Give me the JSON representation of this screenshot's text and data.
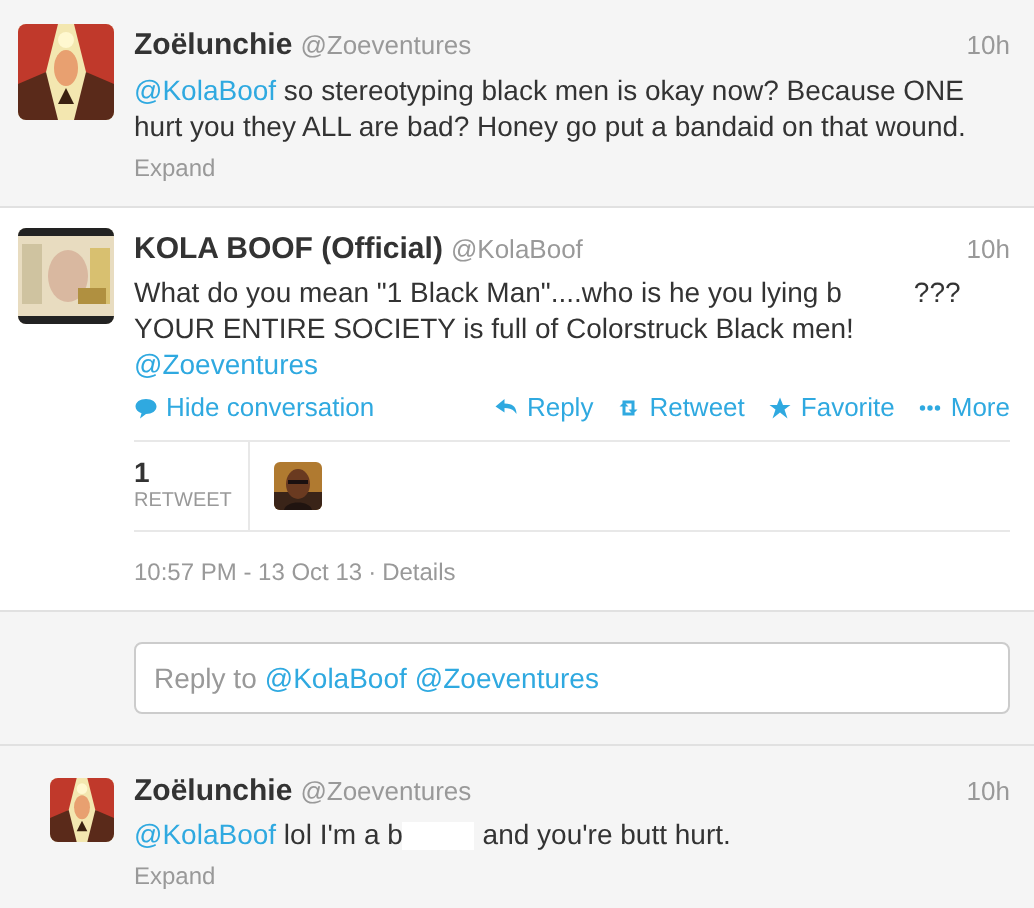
{
  "tweets": [
    {
      "kind": "collapsed",
      "name": "Zoëlunchie",
      "handle": "@Zoeventures",
      "time": "10h",
      "body": [
        {
          "kind": "mention",
          "text": "@KolaBoof"
        },
        {
          "kind": "text",
          "text": " so stereotyping black men is okay now? Because ONE hurt you they ALL are bad? Honey go put a bandaid on that wound."
        }
      ],
      "expand": "Expand"
    },
    {
      "kind": "open",
      "name": "KOLA BOOF (Official)",
      "handle": "@KolaBoof",
      "time": "10h",
      "body": [
        {
          "kind": "text",
          "text": "What do you mean \"1 Black Man\"....who is he you lying b"
        },
        {
          "kind": "redaction"
        },
        {
          "kind": "text",
          "text": "???"
        },
        {
          "kind": "break"
        },
        {
          "kind": "text",
          "text": "YOUR ENTIRE SOCIETY is full of Colorstruck Black men!"
        },
        {
          "kind": "break"
        },
        {
          "kind": "mention",
          "text": "@Zoeventures"
        }
      ],
      "hide_conversation": "Hide conversation",
      "actions": [
        {
          "kind": "reply",
          "label": "Reply"
        },
        {
          "kind": "retweet",
          "label": "Retweet"
        },
        {
          "kind": "favorite",
          "label": "Favorite"
        },
        {
          "kind": "more",
          "label": "More"
        }
      ],
      "stats": {
        "count": "1",
        "label": "RETWEET"
      },
      "timestamp": "10:57 PM - 13 Oct 13",
      "separator": "·",
      "details": "Details"
    },
    {
      "kind": "reply_box",
      "prefix": "Reply to",
      "mentions": [
        "@KolaBoof",
        "@Zoeventures"
      ]
    },
    {
      "kind": "collapsed",
      "name": "Zoëlunchie",
      "handle": "@Zoeventures",
      "time": "10h",
      "body": [
        {
          "kind": "mention",
          "text": "@KolaBoof"
        },
        {
          "kind": "text",
          "text": " lol I'm a b"
        },
        {
          "kind": "redaction"
        },
        {
          "kind": "text",
          "text": " and you're butt hurt."
        }
      ],
      "expand": "Expand",
      "small_avatar": true
    }
  ]
}
